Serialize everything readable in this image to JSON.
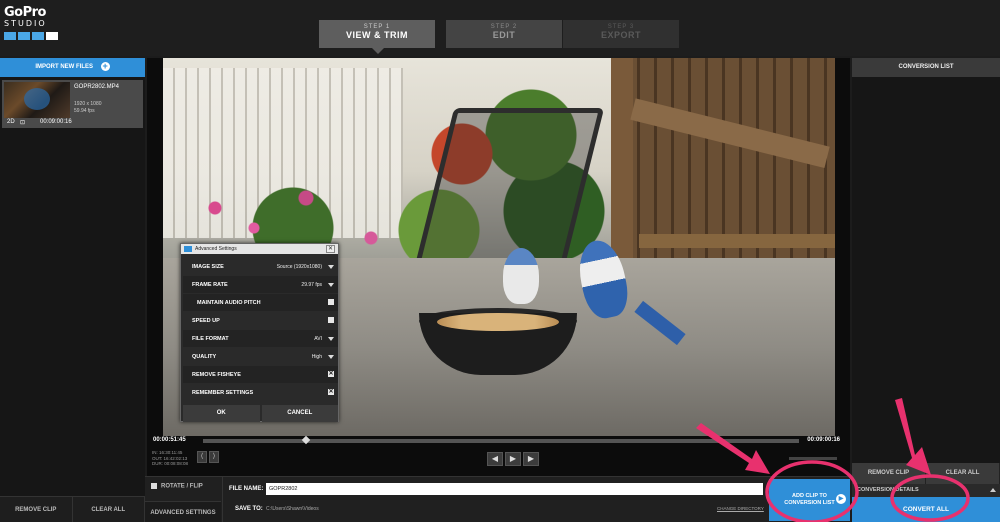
{
  "logo": {
    "line1": "GoPro",
    "line2": "STUDIO"
  },
  "steps": [
    {
      "num": "STEP 1",
      "label": "VIEW & TRIM"
    },
    {
      "num": "STEP 2",
      "label": "EDIT"
    },
    {
      "num": "STEP 3",
      "label": "EXPORT"
    }
  ],
  "left_panel": {
    "import_label": "IMPORT NEW FILES",
    "file": {
      "name": "GOPR2802.MP4",
      "resolution": "1920 x 1080",
      "fps": "59.94 fps",
      "mode": "2D",
      "duration": "00:09:00:16"
    },
    "remove_clip": "REMOVE CLIP",
    "clear_all": "CLEAR ALL"
  },
  "advanced_settings": {
    "title": "Advanced Settings",
    "close": "✕",
    "rows": [
      {
        "label": "IMAGE SIZE",
        "value": "Source (1920x1080)"
      },
      {
        "label": "FRAME RATE",
        "value": "29.97 fps"
      },
      {
        "label": "MAINTAIN AUDIO PITCH"
      },
      {
        "label": "SPEED UP"
      },
      {
        "label": "FILE FORMAT",
        "value": "AVI"
      },
      {
        "label": "QUALITY",
        "value": "High"
      },
      {
        "label": "REMOVE FISHEYE"
      },
      {
        "label": "REMEMBER SETTINGS"
      }
    ],
    "ok": "OK",
    "cancel": "CANCEL"
  },
  "timeline": {
    "start": "00:00:51:45",
    "end": "00:09:00:16",
    "in": "IN: 16:30:11:45",
    "out": "OUT: 16:42:02:13",
    "dur": "DUR: 00:08:08:08"
  },
  "bottom": {
    "rotate_flip": "ROTATE / FLIP",
    "advanced_settings": "ADVANCED SETTINGS",
    "file_name_label": "FILE NAME:",
    "file_name_value": "GOPR2802",
    "save_to_label": "SAVE TO:",
    "save_to_path": "C:\\Users\\Shawn\\Videos",
    "change_directory": "CHANGE DIRECTORY",
    "add_clip_line1": "ADD CLIP TO",
    "add_clip_line2": "CONVERSION LIST"
  },
  "right_panel": {
    "header": "CONVERSION LIST",
    "remove_clip": "REMOVE CLIP",
    "clear_all": "CLEAR ALL",
    "conversion_details": "CONVERSION DETAILS",
    "convert_all": "CONVERT ALL"
  },
  "colors": {
    "accent": "#2f8fd8",
    "annotation": "#e8316e"
  }
}
